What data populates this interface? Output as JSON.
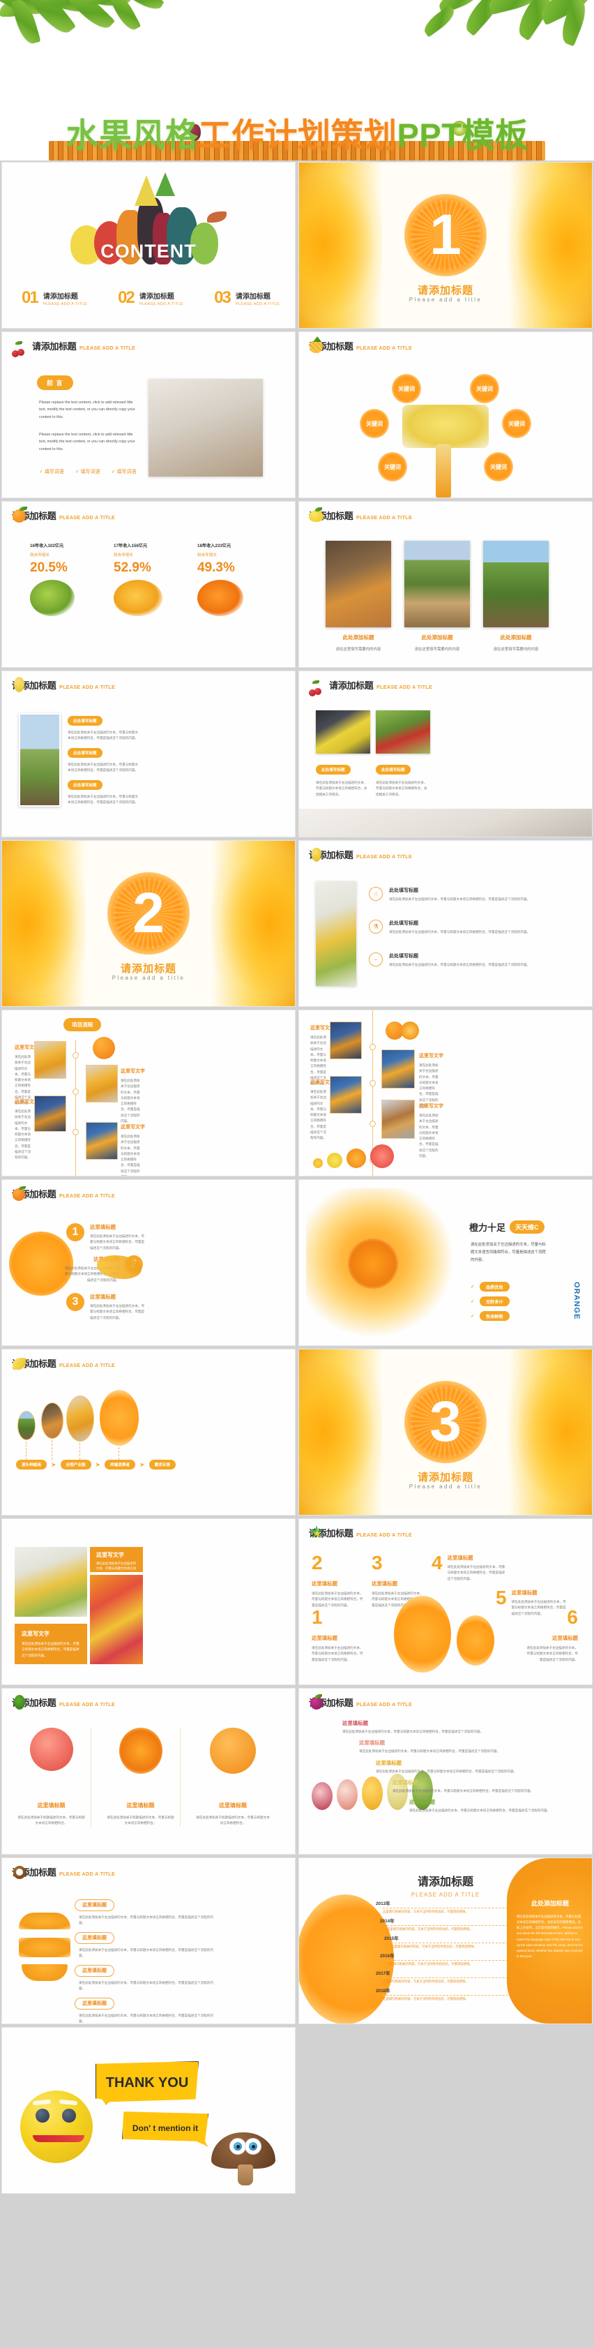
{
  "hero": {
    "title_part1": "水果风格",
    "title_part2": "工作计划策划",
    "title_part3": "PPT模板"
  },
  "common": {
    "title_zh": "请添加标题",
    "title_en": "PLEASE ADD A TITLE",
    "title_en_mixed": "Please add a title",
    "fill_title": "此处填写标题",
    "here_title": "这里填标题",
    "here_text": "这里写文字",
    "add_title_here": "此处添加标题",
    "body_left": "请在此处添加关于左边描述的文本，尽量与标题文本语言风格相符合，尽量是描述这个流程的内容。",
    "body_title_desc": "请在此处添加关于标题描述的文本，尽量与标题文本语言风格相符合。",
    "body_need": "请在这里填写需要内的内容",
    "body_summary": "请在此处添加关于左边描述的文本，尽量与标题文本语言风格相符合，总结相关工作情况。",
    "fill_word": "填写词语"
  },
  "slides": {
    "content": {
      "label": "CONTENT",
      "items": [
        {
          "num": "01",
          "zh": "请添加标题",
          "en": "PLEASE ADD A TITLE"
        },
        {
          "num": "02",
          "zh": "请添加标题",
          "en": "PLEASE ADD A TITLE"
        },
        {
          "num": "03",
          "zh": "请添加标题",
          "en": "PLEASE ADD A TITLE"
        }
      ]
    },
    "divider1": {
      "num": "1",
      "zh": "请添加标题",
      "en": "Please add a title"
    },
    "divider2": {
      "num": "2",
      "zh": "请添加标题",
      "en": "Please add a title"
    },
    "divider3": {
      "num": "3",
      "zh": "请添加标题",
      "en": "Please add a title"
    },
    "preface": {
      "title_zh": "请添加标题",
      "title_en": "PLEASE ADD A TITLE",
      "badge": "前 言",
      "para1": "Please replace the text content, click to add relevant title text, modify the text content, or you can directly copy your content to this.",
      "para2": "Please replace the text content, click to add relevant title text, modify the text content, or you can directly copy your content to this.",
      "checks": [
        "填写词语",
        "填写词语",
        "填写词语"
      ]
    },
    "keywords": {
      "title_zh": "请添加标题",
      "title_en": "PLEASE ADD A TITLE",
      "items": [
        "关键词",
        "关键词",
        "关键词",
        "关键词",
        "关键词",
        "关键词"
      ]
    },
    "three_photos": {
      "title_zh": "请添加标题",
      "title_en": "PLEASE ADD A TITLE",
      "cards": [
        {
          "title": "此处添加标题",
          "desc": "请在这里填写需要内的内容"
        },
        {
          "title": "此处添加标题",
          "desc": "请在这里填写需要内的内容"
        },
        {
          "title": "此处添加标题",
          "desc": "请在这里填写需要内的内容"
        }
      ]
    },
    "three_steps": {
      "title_zh": "请添加标题",
      "title_en": "PLEASE ADD A TITLE",
      "items": [
        {
          "title": "此处填写标题",
          "desc": "请在此处添加关于左边描述的文本，尽量与标题文本语言风格相符合，尽量是描述这个流程的内容。"
        },
        {
          "title": "此处填写标题",
          "desc": "请在此处添加关于左边描述的文本，尽量与标题文本语言风格相符合，尽量是描述这个流程的内容。"
        },
        {
          "title": "此处填写标题",
          "desc": "请在此处添加关于左边描述的文本，尽量与标题文本语言风格相符合，尽量是描述这个流程的内容。"
        }
      ]
    },
    "two_photos": {
      "title_zh": "请添加标题",
      "title_en": "PLEASE ADD A TITLE",
      "items": [
        {
          "title": "此处填写标题",
          "desc": "请在此处添加关于左边描述的文本，尽量与标题文本语言风格相符合，总结相关工作情况。"
        },
        {
          "title": "此处填写标题",
          "desc": "请在此处添加关于左边描述的文本，尽量与标题文本语言风格相符合，总结相关工作情况。"
        }
      ]
    },
    "icon_list": {
      "title_zh": "请添加标题",
      "title_en": "PLEASE ADD A TITLE",
      "items": [
        {
          "icon": "hand-icon",
          "title": "此处填写标题",
          "desc": "请在此处添加关于左边描述的文本，尽量与标题文本语言风格相符合，尽量是描述这个流程的内容。"
        },
        {
          "icon": "bottle-icon",
          "title": "此处填写标题",
          "desc": "请在此处添加关于左边描述的文本，尽量与标题文本语言风格相符合，尽量是描述这个流程的内容。"
        },
        {
          "icon": "basket-icon",
          "title": "此处填写标题",
          "desc": "请在此处添加关于左边描述的文本，尽量与标题文本语言风格相符合，尽量是描述这个流程的内容。"
        }
      ]
    },
    "process_left": {
      "badge": "项目流程",
      "items": [
        {
          "title": "这里写文字",
          "desc": "请在此处添加关于左边描述的文本，尽量与标题文本语言风格相符合，尽量是描述这个流程的内容。"
        },
        {
          "title": "这里写文字",
          "desc": "请在此处添加关于左边描述的文本，尽量与标题文本语言风格相符合，尽量是描述这个流程的内容。"
        },
        {
          "title": "这里写文字",
          "desc": "请在此处添加关于左边描述的文本，尽量与标题文本语言风格相符合，尽量是描述这个流程的内容。"
        },
        {
          "title": "这里写文字",
          "desc": "请在此处添加关于左边描述的文本，尽量与标题文本语言风格相符合，尽量是描述这个流程的内容。"
        }
      ]
    },
    "process_right": {
      "items": [
        {
          "title": "这里写文字",
          "desc": "请在此处添加关于左边描述的文本，尽量与标题文本语言风格相符合，尽量是描述这个流程的内容。"
        },
        {
          "title": "这里写文字",
          "desc": "请在此处添加关于左边描述的文本，尽量与标题文本语言风格相符合，尽量是描述这个流程的内容。"
        },
        {
          "title": "这里写文字",
          "desc": "请在此处添加关于左边描述的文本，尽量与标题文本语言风格相符合，尽量是描述这个流程的内容。"
        },
        {
          "title": "这里写文字",
          "desc": "请在此处添加关于左边描述的文本，尽量与标题文本语言风格相符合，尽量是描述这个流程的内容。"
        }
      ]
    },
    "numbered123": {
      "title_zh": "请添加标题",
      "title_en": "PLEASE ADD A TITLE",
      "items": [
        {
          "num": "1",
          "title": "这里填标题",
          "desc": "请在此处添加关于左边描述的文本，尽量与标题文本语言风格相符合，尽量是描述这个流程的内容。"
        },
        {
          "num": "2",
          "title": "这里填标题",
          "desc": "请在此处添加关于左边描述的文本，尽量与标题文本语言风格相符合，尽量是描述这个流程的内容。"
        },
        {
          "num": "3",
          "title": "这里填标题",
          "desc": "请在此处添加关于左边描述的文本，尽量与标题文本语言风格相符合，尽量是描述这个流程的内容。"
        }
      ]
    },
    "orange_promo": {
      "headline": "橙力十足",
      "badge": "天天维C",
      "desc": "请在此处添加关于左边描述的文本，尽量与标题文本语言风格相符合，尽量是描述这个流程的内容。",
      "tags": [
        "品质优良",
        "无籽多汁",
        "色泽鲜艳"
      ],
      "vertical": "ORANGE"
    },
    "supply_chain": {
      "title_zh": "请添加标题",
      "title_en": "PLEASE ADD A TITLE",
      "steps": [
        "源头种植商",
        "全程产业链",
        "终端消费者",
        "需求反馈"
      ]
    },
    "photo_blocks": {
      "blocks": [
        {
          "title": "这里写文字",
          "desc": "请在此处添加关于左边描述的文本，尽量与标题文本语言风格相符合，尽量是描述这个流程的内容。"
        },
        {
          "title": "这里写文字",
          "desc": "请在此处添加关于左边描述的文本，尽量与标题文本语言风格相符合，尽量是描述这个流程的内容。"
        }
      ]
    },
    "numbers_2to6": {
      "title_zh": "请添加标题",
      "title_en": "PLEASE ADD A TITLE",
      "items": [
        {
          "num": "2",
          "title": "这里填标题",
          "desc": "请在此处添加关于左边描述的文本，尽量与标题文本语言风格相符合，尽量是描述这个流程的内容。"
        },
        {
          "num": "3",
          "title": "这里填标题",
          "desc": "请在此处添加关于左边描述的文本，尽量与标题文本语言风格相符合，尽量是描述这个流程的内容。"
        },
        {
          "num": "4",
          "title": "这里填标题",
          "desc": "请在此处添加关于左边描述的文本，尽量与标题文本语言风格相符合，尽量是描述这个流程的内容。"
        },
        {
          "num": "5",
          "title": "这里填标题",
          "desc": "请在此处添加关于左边描述的文本，尽量与标题文本语言风格相符合，尽量是描述这个流程的内容。"
        },
        {
          "num": "1",
          "title": "这里填标题",
          "desc": "请在此处添加关于左边描述的文本，尽量与标题文本语言风格相符合，尽量是描述这个流程的内容。"
        },
        {
          "num": "6",
          "title": "这里填标题",
          "desc": "请在此处添加关于左边描述的文本，尽量与标题文本语言风格相符合，尽量是描述这个流程的内容。"
        }
      ]
    },
    "three_fruit_cards": {
      "title_zh": "请添加标题",
      "title_en": "PLEASE ADD A TITLE",
      "cards": [
        {
          "title": "这里填标题",
          "desc": "请在此处添加关于标题描述的文本，尽量与标题文本语言风格相符合。"
        },
        {
          "title": "这里填标题",
          "desc": "请在此处添加关于标题描述的文本，尽量与标题文本语言风格相符合。"
        },
        {
          "title": "这里填标题",
          "desc": "请在此处添加关于标题描述的文本，尽量与标题文本语言风格相符合。"
        }
      ]
    },
    "staircase": {
      "title_zh": "请添加标题",
      "title_en": "PLEASE ADD A TITLE",
      "items": [
        {
          "title": "这里填标题",
          "desc": "请在此处添加关于左边描述的文本，尽量与标题文本语言风格相符合，尽量是描述这个流程的内容。"
        },
        {
          "title": "这里填标题",
          "desc": "请在此处添加关于左边描述的文本，尽量与标题文本语言风格相符合，尽量是描述这个流程的内容。"
        },
        {
          "title": "这里填标题",
          "desc": "请在此处添加关于左边描述的文本，尽量与标题文本语言风格相符合，尽量是描述这个流程的内容。"
        },
        {
          "title": "这里填标题",
          "desc": "请在此处添加关于左边描述的文本，尽量与标题文本语言风格相符合，尽量是描述这个流程的内容。"
        },
        {
          "title": "这里填标题",
          "desc": "请在此处添加关于左边描述的文本，尽量与标题文本语言风格相符合，尽量是描述这个流程的内容。"
        }
      ]
    },
    "orange_stack": {
      "title_zh": "请添加标题",
      "title_en": "PLEASE ADD A TITLE",
      "items": [
        {
          "title": "这里填标题",
          "desc": "请在此处添加关于左边描述的文本，尽量与标题文本语言风格相符合，尽量是描述这个流程的内容。"
        },
        {
          "title": "这里填标题",
          "desc": "请在此处添加关于左边描述的文本，尽量与标题文本语言风格相符合，尽量是描述这个流程的内容。"
        },
        {
          "title": "这里填标题",
          "desc": "请在此处添加关于左边描述的文本，尽量与标题文本语言风格相符合，尽量是描述这个流程的内容。"
        },
        {
          "title": "这里填标题",
          "desc": "请在此处添加关于左边描述的文本，尽量与标题文本语言风格相符合，尽量是描述这个流程的内容。"
        }
      ]
    },
    "years_timeline": {
      "title_zh": "请添加标题",
      "title_en": "PLEASE ADD A TITLE",
      "rows": [
        {
          "year": "2013年",
          "desc": "这里填写相关的内容，写关于当时的举措总结，尽量简短明快。"
        },
        {
          "year": "2014年",
          "desc": "这里填写相关的内容，写关于当时的举措总结，尽量简短明快。"
        },
        {
          "year": "2015年",
          "desc": "这里填写相关的内容，写关于当时的举措总结，尽量简短明快。"
        },
        {
          "year": "2016年",
          "desc": "这里填写相关的内容，写关于当时的举措总结，尽量简短明快。"
        },
        {
          "year": "2017年",
          "desc": "这里填写相关的内容，写关于当时的举措总结，尽量简短明快。"
        },
        {
          "year": "2018年",
          "desc": "这里填写相关的内容，写关于当时的举措总结，尽量简短明快。"
        }
      ],
      "side_title": "此处添加标题",
      "side_desc": "请在此处添加关于左边描述的文本，尽量与标题文本语言风格相符合，总结多年的销售情况，比如上升趋势，当年是否收到侵灾。Please add the text about the left description here, and try to match the language style of the title text to sum up the sales situation over the years, such as the upward trend, whether the disaster was received in that year."
    },
    "thanks": {
      "bubble1": "THANK YOU",
      "bubble2": "Don' t mention it"
    }
  },
  "chart_data": {
    "type": "bar",
    "title": "请添加标题",
    "subtitle": "PLEASE ADD A TITLE",
    "categories": [
      "16年收入102亿元",
      "17年收入156亿元",
      "18年收入233亿元"
    ],
    "series": [
      {
        "name": "较去年增长",
        "values": [
          20.5,
          52.9,
          49.3
        ]
      }
    ],
    "value_labels": [
      "20.5%",
      "52.9%",
      "49.3%"
    ],
    "sub_labels": [
      "较去年增长",
      "较去年增长",
      "较去年增长"
    ],
    "revenue_values": [
      102,
      156,
      233
    ],
    "revenue_unit": "亿元",
    "years": [
      "16年",
      "17年",
      "18年"
    ],
    "xlabel": "",
    "ylabel": "",
    "ylim": [
      0,
      100
    ],
    "grid": false,
    "legend": "none",
    "accent_color": "#ef8b1b"
  },
  "colors": {
    "accent_orange": "#f5a623",
    "deep_orange": "#ef8b1b",
    "green": "#79c143",
    "title_green": "#6eb82f",
    "text_dark": "#2d2d2d",
    "text_gray": "#7a7a7a",
    "page_bg": "#d2d2d2"
  }
}
